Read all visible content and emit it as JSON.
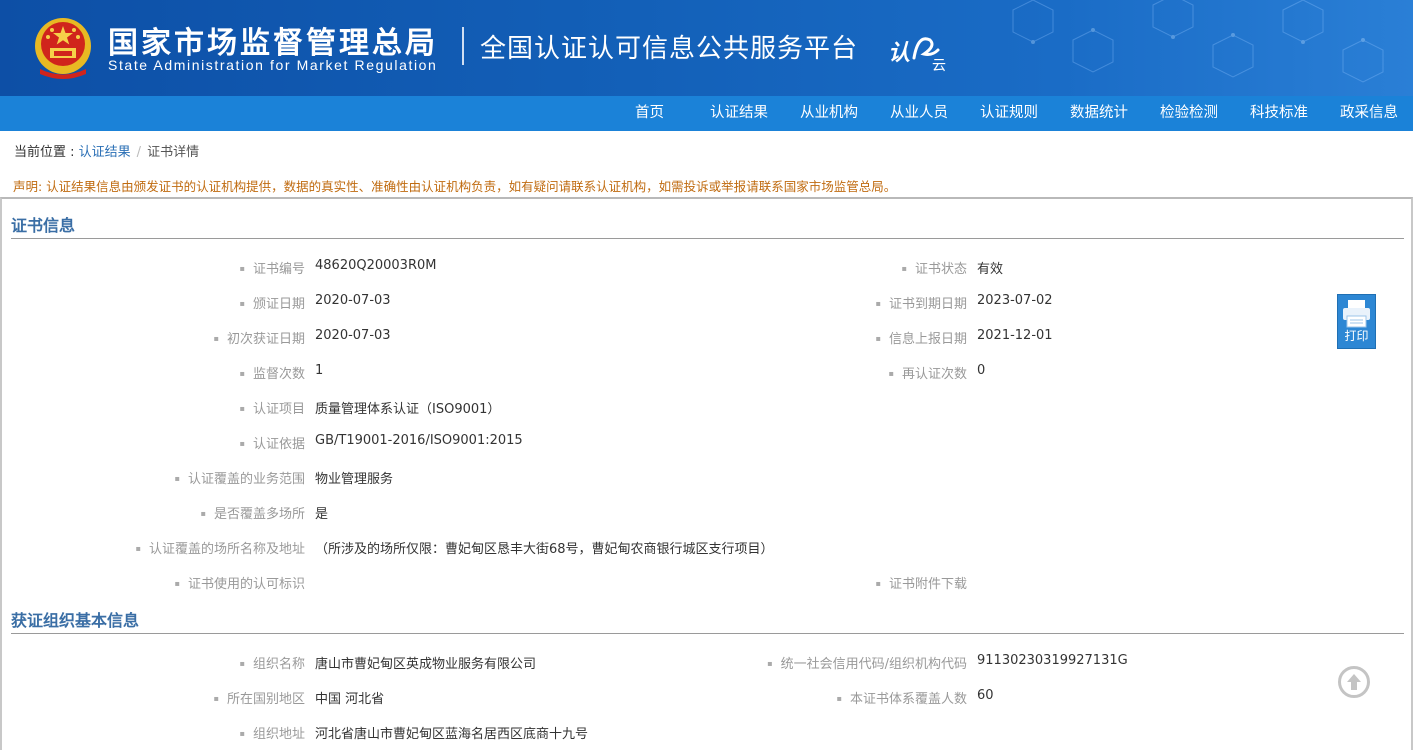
{
  "header": {
    "org_name_cn": "国家市场监督管理总局",
    "org_name_en": "State Administration  for  Market Regulation",
    "platform_title": "全国认证认可信息公共服务平台",
    "platform_logo_text": "认证云",
    "brand_color": "#0d4fa6"
  },
  "nav": {
    "items": [
      "首页",
      "认证结果",
      "从业机构",
      "从业人员",
      "认证规则",
      "数据统计",
      "检验检测",
      "科技标准",
      "政采信息"
    ]
  },
  "breadcrumb": {
    "prefix": "当前位置 : ",
    "link": "认证结果",
    "separator": "/",
    "current": "证书详情"
  },
  "notice": "声明: 认证结果信息由颁发证书的认证机构提供，数据的真实性、准确性由认证机构负责，如有疑问请联系认证机构，如需投诉或举报请联系国家市场监管总局。",
  "cert_section": {
    "title": "证书信息",
    "left": [
      {
        "label": "证书编号",
        "value": "48620Q20003R0M"
      },
      {
        "label": "颁证日期",
        "value": "2020-07-03"
      },
      {
        "label": "初次获证日期",
        "value": "2020-07-03"
      },
      {
        "label": "监督次数",
        "value": "1"
      },
      {
        "label": "认证项目",
        "value": "质量管理体系认证（ISO9001）"
      },
      {
        "label": "认证依据",
        "value": "GB/T19001-2016/ISO9001:2015"
      },
      {
        "label": "认证覆盖的业务范围",
        "value": "物业管理服务"
      },
      {
        "label": "是否覆盖多场所",
        "value": "是"
      },
      {
        "label": "认证覆盖的场所名称及地址",
        "value": "（所涉及的场所仅限：曹妃甸区恳丰大街68号，曹妃甸农商银行城区支行项目）"
      },
      {
        "label": "证书使用的认可标识",
        "value": ""
      }
    ],
    "right": [
      {
        "label": "证书状态",
        "value": "有效"
      },
      {
        "label": "证书到期日期",
        "value": "2023-07-02"
      },
      {
        "label": "信息上报日期",
        "value": "2021-12-01"
      },
      {
        "label": "再认证次数",
        "value": "0"
      },
      {
        "label": "证书附件下载",
        "value": ""
      }
    ]
  },
  "org_section": {
    "title": "获证组织基本信息",
    "left": [
      {
        "label": "组织名称",
        "value": "唐山市曹妃甸区英成物业服务有限公司"
      },
      {
        "label": "所在国别地区",
        "value": "中国 河北省"
      },
      {
        "label": "组织地址",
        "value": "河北省唐山市曹妃甸区蓝海名居西区底商十九号"
      }
    ],
    "right": [
      {
        "label": "统一社会信用代码/组织机构代码",
        "value": "91130230319927131G"
      },
      {
        "label": "本证书体系覆盖人数",
        "value": "60"
      }
    ]
  },
  "actions": {
    "print_label": "打印",
    "back_to_top_icon": "arrow-up-circle-icon",
    "print_icon": "printer-icon"
  }
}
